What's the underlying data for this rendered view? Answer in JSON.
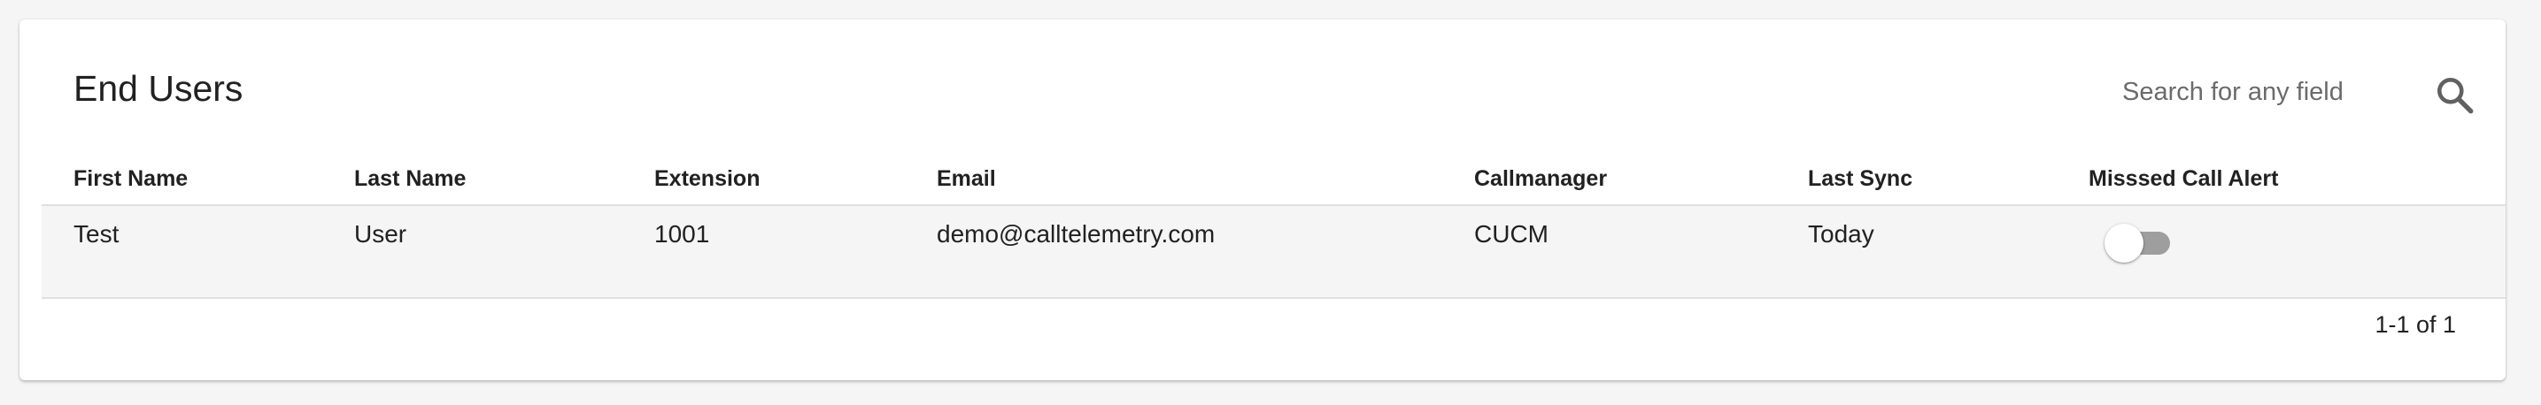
{
  "header": {
    "title": "End Users",
    "search_placeholder": "Search for any field",
    "search_icon": "search-icon"
  },
  "table": {
    "columns": [
      "First Name",
      "Last Name",
      "Extension",
      "Email",
      "Callmanager",
      "Last Sync",
      "Misssed Call Alert"
    ],
    "rows": [
      {
        "first_name": "Test",
        "last_name": "User",
        "extension": "1001",
        "email": "demo@calltelemetry.com",
        "callmanager": "CUCM",
        "last_sync": "Today",
        "missed_call_alert": false
      }
    ]
  },
  "pagination": {
    "range": "1-1 of 1"
  },
  "colors": {
    "toggle_track_off": "#9e9e9e",
    "row_background": "#f5f5f5"
  }
}
